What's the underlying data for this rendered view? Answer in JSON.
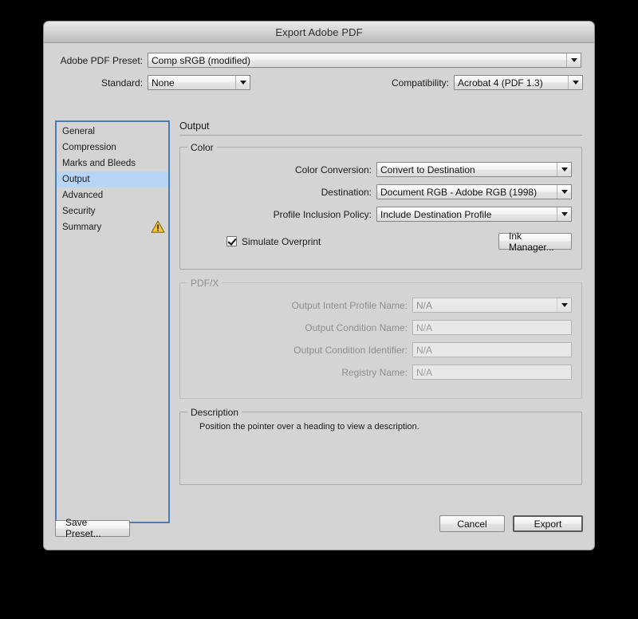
{
  "window": {
    "title": "Export Adobe PDF"
  },
  "top": {
    "preset_label": "Adobe PDF Preset:",
    "preset_value": "Comp sRGB (modified)",
    "standard_label": "Standard:",
    "standard_value": "None",
    "compatibility_label": "Compatibility:",
    "compatibility_value": "Acrobat 4 (PDF 1.3)"
  },
  "sidebar": {
    "items": [
      {
        "label": "General",
        "selected": false,
        "warning": false
      },
      {
        "label": "Compression",
        "selected": false,
        "warning": false
      },
      {
        "label": "Marks and Bleeds",
        "selected": false,
        "warning": false
      },
      {
        "label": "Output",
        "selected": true,
        "warning": false
      },
      {
        "label": "Advanced",
        "selected": false,
        "warning": false
      },
      {
        "label": "Security",
        "selected": false,
        "warning": false
      },
      {
        "label": "Summary",
        "selected": false,
        "warning": true
      }
    ]
  },
  "pane": {
    "title": "Output",
    "color_group": {
      "legend": "Color",
      "rows": [
        {
          "label": "Color Conversion:",
          "value": "Convert to Destination"
        },
        {
          "label": "Destination:",
          "value": "Document RGB - Adobe RGB (1998)"
        },
        {
          "label": "Profile Inclusion Policy:",
          "value": "Include Destination Profile"
        }
      ],
      "simulate_overprint_label": "Simulate Overprint",
      "simulate_overprint_checked": true,
      "ink_manager_label": "Ink Manager..."
    },
    "pdfx_group": {
      "legend": "PDF/X",
      "rows": [
        {
          "label": "Output Intent Profile Name:",
          "value": "N/A",
          "type": "select"
        },
        {
          "label": "Output Condition Name:",
          "value": "N/A",
          "type": "text"
        },
        {
          "label": "Output Condition Identifier:",
          "value": "N/A",
          "type": "text"
        },
        {
          "label": "Registry Name:",
          "value": "N/A",
          "type": "text"
        }
      ]
    },
    "description_group": {
      "legend": "Description",
      "text": "Position the pointer over a heading to view a description."
    }
  },
  "footer": {
    "save_preset_label": "Save Preset...",
    "cancel_label": "Cancel",
    "export_label": "Export"
  },
  "colors": {
    "selection_blue": "#b9d5f5",
    "focus_border_blue": "#4a7fb5",
    "warning_yellow": "#f2c230",
    "window_bg": "#d4d4d4"
  }
}
